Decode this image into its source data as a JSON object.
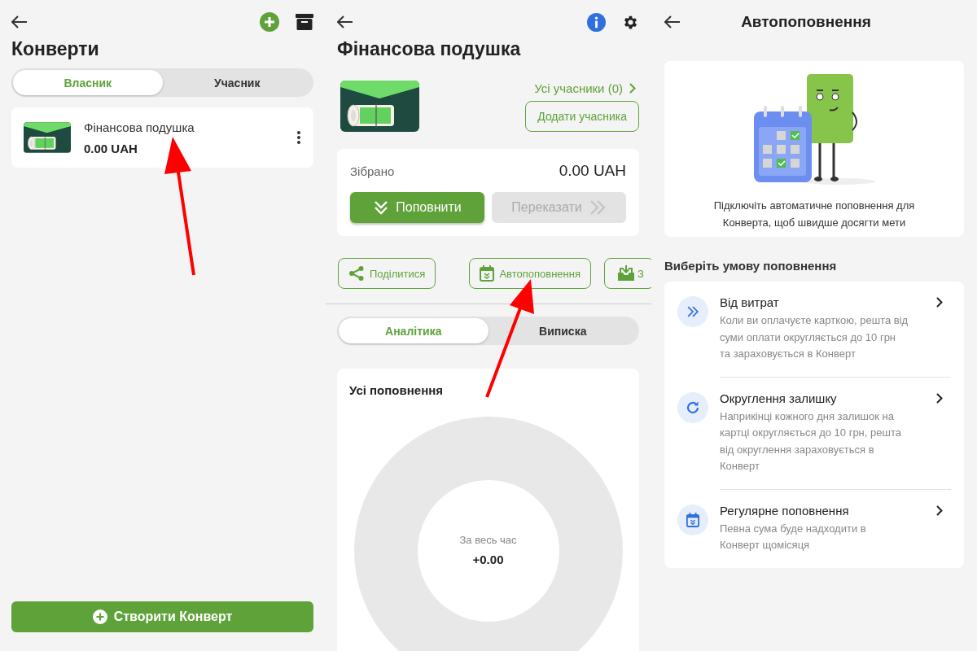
{
  "envelopes_screen": {
    "title": "Конверти",
    "tabs": [
      {
        "label": "Власник",
        "selected": true
      },
      {
        "label": "Учасник",
        "selected": false
      }
    ],
    "envelopes": [
      {
        "name": "Фінансова подушка",
        "amount": "0.00 UAH"
      }
    ],
    "create_button": "Створити Конверт"
  },
  "envelope_screen": {
    "title": "Фінансова подушка",
    "members_link": "Усі учасники (0)",
    "add_member_button": "Додати учасника",
    "collected_label": "Зібрано",
    "collected_amount": "0.00 UAH",
    "main_buttons": [
      {
        "label": "Поповнити",
        "disabled": false
      },
      {
        "label": "Переказати",
        "disabled": true
      }
    ],
    "actions": [
      "Поділитися",
      "Автопоповнення",
      "З"
    ],
    "tabs": [
      {
        "label": "Аналітика",
        "selected": true
      },
      {
        "label": "Виписка",
        "selected": false
      }
    ],
    "chart_title": "Усі поповнення",
    "chart_caption": "За весь час",
    "chart_total": "+0.00"
  },
  "autofill_screen": {
    "title": "Автопоповнення",
    "intro": "Підключіть автоматичне поповнення для Конверта, щоб швидше досягти мети",
    "section_title": "Виберіть умову поповнення",
    "options": [
      {
        "title": "Від витрат",
        "description": "Коли ви оплачуєте карткою, решта від суми оплати округляється до 10 грн та зараховується в Конверт"
      },
      {
        "title": "Округлення залишку",
        "description": "Наприкінці кожного дня залишок на картці округляється до 10 грн, решта від округлення зараховується в Конверт"
      },
      {
        "title": "Регулярне поповнення",
        "description": "Певна сума буде надходити в Конверт щомісяця"
      }
    ]
  }
}
